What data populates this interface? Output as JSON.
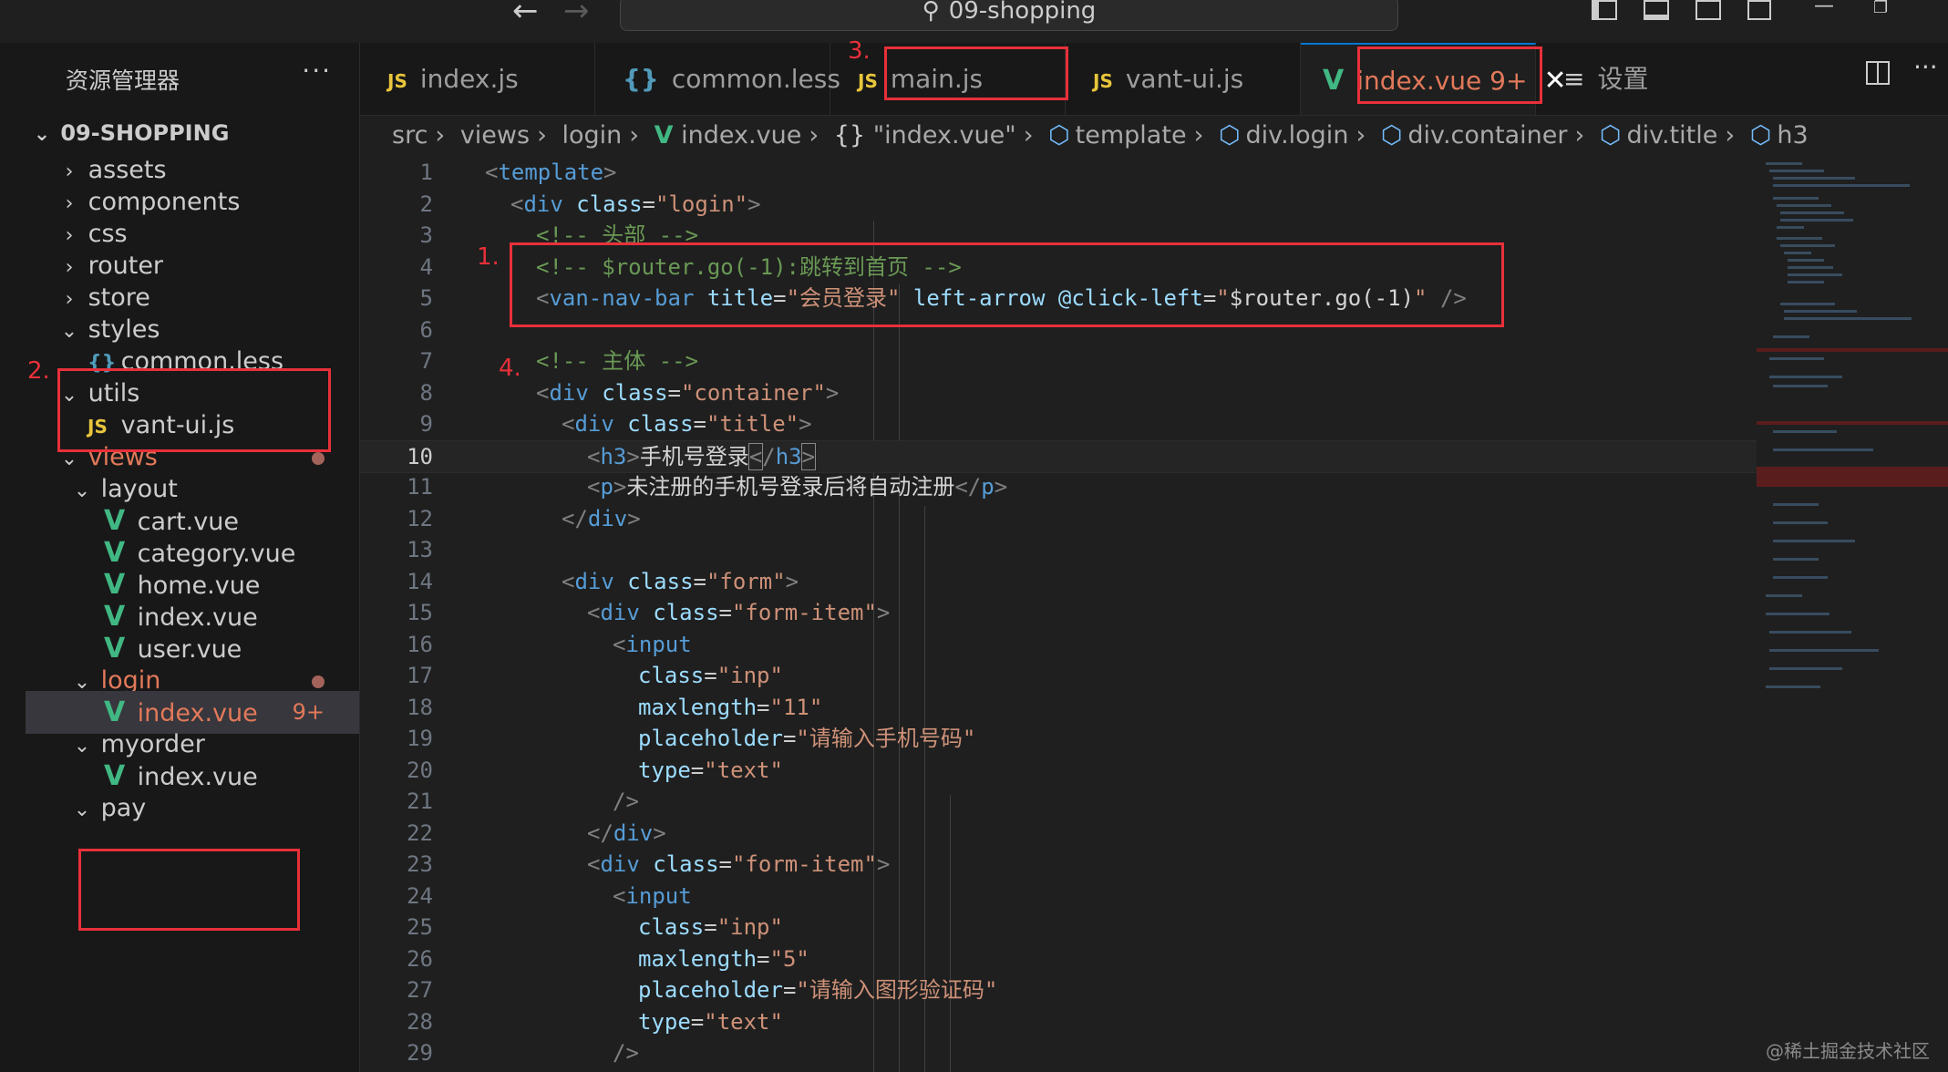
{
  "titlebar": {
    "back_icon": "arrow-left-icon",
    "forward_icon": "arrow-right-icon",
    "search_text": "09-shopping"
  },
  "sidebar": {
    "title": "资源管理器",
    "more": "···",
    "root": "09-SHOPPING",
    "items": [
      {
        "label": "assets"
      },
      {
        "label": "components"
      },
      {
        "label": "css"
      },
      {
        "label": "router"
      },
      {
        "label": "store"
      },
      {
        "label": "styles"
      },
      {
        "label": "common.less"
      },
      {
        "label": "utils"
      },
      {
        "label": "vant-ui.js"
      },
      {
        "label": "views"
      },
      {
        "label": "layout"
      },
      {
        "label": "cart.vue"
      },
      {
        "label": "category.vue"
      },
      {
        "label": "home.vue"
      },
      {
        "label": "index.vue"
      },
      {
        "label": "user.vue"
      },
      {
        "label": "login"
      },
      {
        "label": "index.vue",
        "badge": "9+"
      },
      {
        "label": "myorder"
      },
      {
        "label": "index.vue"
      },
      {
        "label": "pay"
      }
    ]
  },
  "tabs": [
    {
      "label": "index.js"
    },
    {
      "label": "common.less"
    },
    {
      "label": "main.js"
    },
    {
      "label": "vant-ui.js"
    },
    {
      "label": "index.vue",
      "badge": "9+"
    },
    {
      "label": "设置"
    }
  ],
  "breadcrumb": [
    "src",
    "views",
    "login",
    "index.vue",
    "\"index.vue\"",
    "template",
    "div.login",
    "div.container",
    "div.title",
    "h3"
  ],
  "annotations": [
    "1.",
    "2.",
    "3.",
    "4."
  ],
  "editor": {
    "current_line": "10",
    "lines": [
      {
        "n": "1"
      },
      {
        "n": "2"
      },
      {
        "n": "3"
      },
      {
        "n": "4"
      },
      {
        "n": "5"
      },
      {
        "n": "6"
      },
      {
        "n": "7"
      },
      {
        "n": "8"
      },
      {
        "n": "9"
      },
      {
        "n": "10"
      },
      {
        "n": "11"
      },
      {
        "n": "12"
      },
      {
        "n": "13"
      },
      {
        "n": "14"
      },
      {
        "n": "15"
      },
      {
        "n": "16"
      },
      {
        "n": "17"
      },
      {
        "n": "18"
      },
      {
        "n": "19"
      },
      {
        "n": "20"
      },
      {
        "n": "21"
      },
      {
        "n": "22"
      },
      {
        "n": "23"
      },
      {
        "n": "24"
      },
      {
        "n": "25"
      },
      {
        "n": "26"
      },
      {
        "n": "27"
      },
      {
        "n": "28"
      },
      {
        "n": "29"
      }
    ],
    "code": {
      "l1_tag": "template",
      "l2_tag": "div",
      "l2_attr": "class",
      "l2_val": "\"login\"",
      "l3": "<!-- 头部 -->",
      "l4": "<!-- $router.go(-1):跳转到首页 -->",
      "l5_tag": "van-nav-bar",
      "l5_attr1": "title",
      "l5_val1": "\"会员登录\"",
      "l5_attr2": "left-arrow",
      "l5_attr3": "@click-left",
      "l5_val3_a": "\"",
      "l5_val3_b": "$router.go(-1)",
      "l5_val3_c": "\"",
      "l7": "<!-- 主体 -->",
      "l8_tag": "div",
      "l8_attr": "class",
      "l8_val": "\"container\"",
      "l9_tag": "div",
      "l9_attr": "class",
      "l9_val": "\"title\"",
      "l10_tag": "h3",
      "l10_text": "手机号登录",
      "l11_tag": "p",
      "l11_text": "未注册的手机号登录后将自动注册",
      "l12_tag": "div",
      "l14_tag": "div",
      "l14_attr": "class",
      "l14_val": "\"form\"",
      "l15_tag": "div",
      "l15_attr": "class",
      "l15_val": "\"form-item\"",
      "l16_tag": "input",
      "l17_attr": "class",
      "l17_val": "\"inp\"",
      "l18_attr": "maxlength",
      "l18_val": "\"11\"",
      "l19_attr": "placeholder",
      "l19_val": "\"请输入手机号码\"",
      "l20_attr": "type",
      "l20_val": "\"text\"",
      "l22_tag": "div",
      "l23_tag": "div",
      "l23_attr": "class",
      "l23_val": "\"form-item\"",
      "l24_tag": "input",
      "l25_attr": "class",
      "l25_val": "\"inp\"",
      "l26_attr": "maxlength",
      "l26_val": "\"5\"",
      "l27_attr": "placeholder",
      "l27_val": "\"请输入图形验证码\"",
      "l28_attr": "type",
      "l28_val": "\"text\""
    }
  },
  "watermark": "@稀土掘金技术社区",
  "colors": {
    "annotation_red": "#e8303a",
    "modified": "#e2795a",
    "vue_green": "#41b883",
    "js_yellow": "#e8c53b"
  }
}
